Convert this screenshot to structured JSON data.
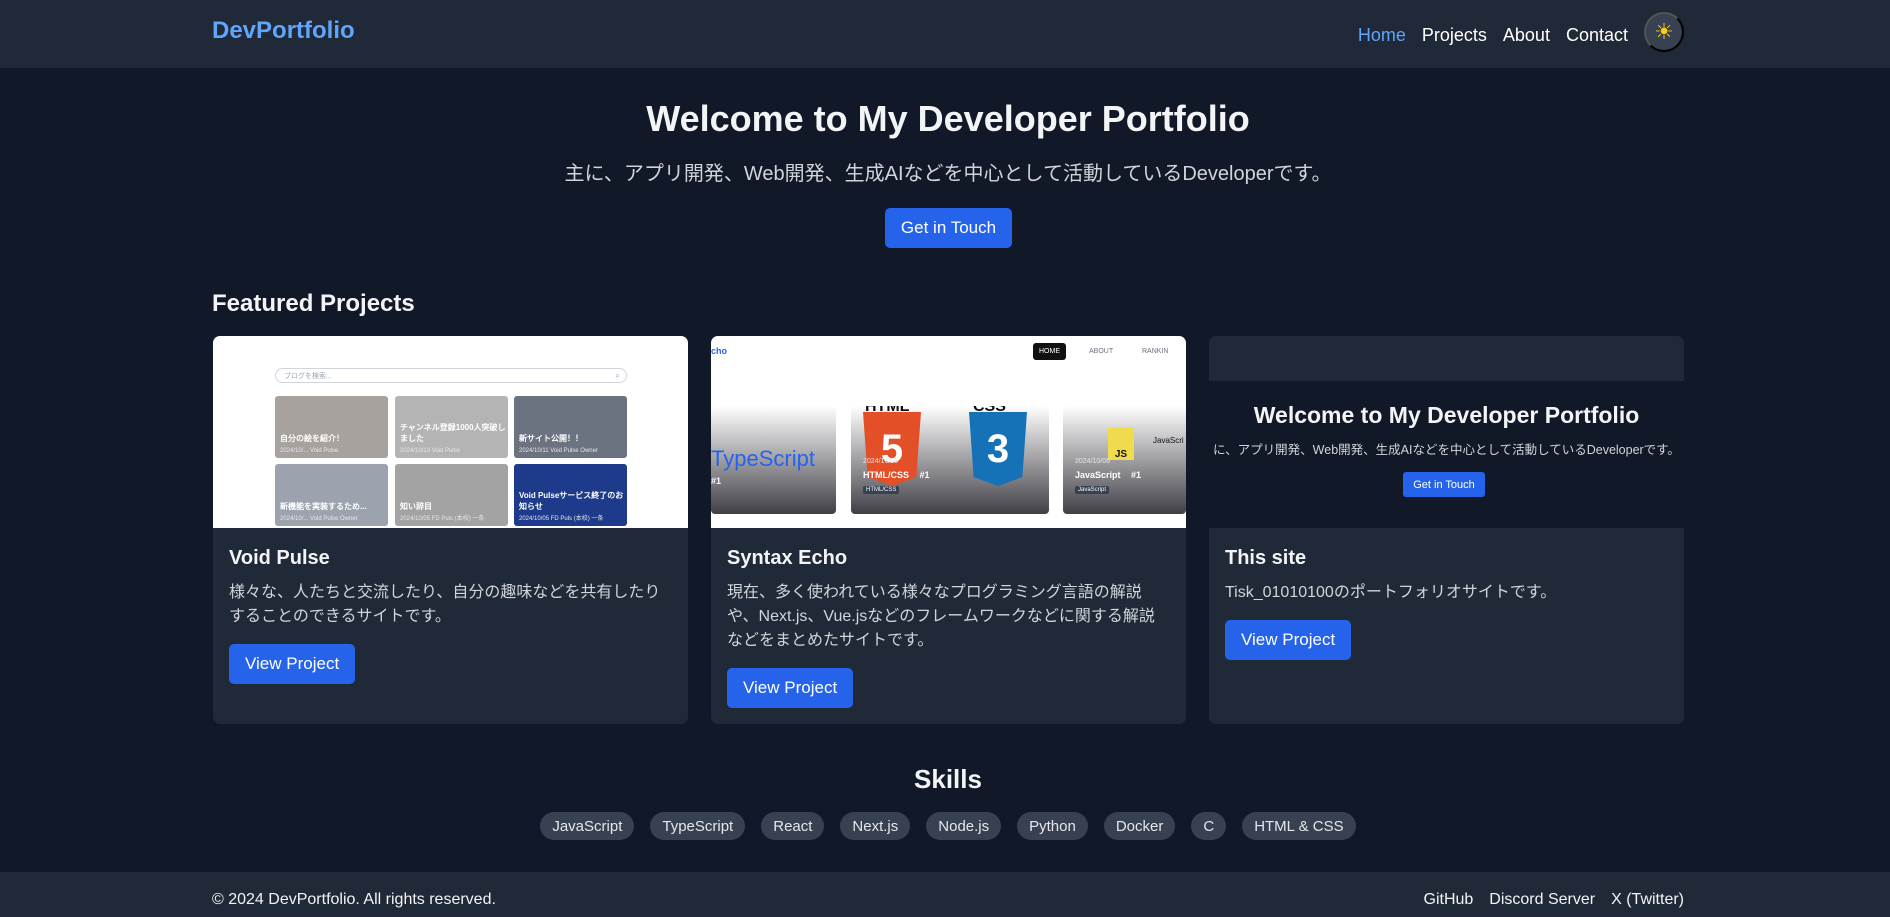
{
  "nav": {
    "brand": "DevPortfolio",
    "links": [
      "Home",
      "Projects",
      "About",
      "Contact"
    ],
    "active": "Home",
    "theme_icon": "☀",
    "theme_icon_name": "sun-icon"
  },
  "hero": {
    "title": "Welcome to My Developer Portfolio",
    "subtitle": "主に、アプリ開発、Web開発、生成AIなどを中心として活動しているDeveloperです。",
    "cta": "Get in Touch"
  },
  "projects_section": {
    "title": "Featured Projects",
    "projects": [
      {
        "title": "Void Pulse",
        "description": "様々な、人たちと交流したり、自分の趣味などを共有したりすることのできるサイトです。",
        "button": "View Project",
        "thumbnail": {
          "search_placeholder": "ブログを検索...",
          "tiles": [
            {
              "title": "自分の絵を紹介！",
              "meta": "2024/10/... Void Pulse"
            },
            {
              "title": "チャンネル登録1000人突破しました",
              "meta": "2024/10/13 Void Pulse"
            },
            {
              "title": "新サイト公開！！",
              "meta": "2024/10/11 Void Pulse Owner"
            },
            {
              "title": "新機能を実装するため...",
              "meta": "2024/10/... Void Pulse Owner"
            },
            {
              "title": "知い辞目",
              "meta": "2024/10/05 FD Puls (本校) 一条"
            },
            {
              "title": "Void Pulseサービス終了のお知らせ",
              "meta": "2024/10/05 FD Puls (本校) 一条"
            }
          ]
        }
      },
      {
        "title": "Syntax Echo",
        "description": "現在、多く使われている様々なプログラミング言語の解説や、Next.js、Vue.jsなどのフレームワークなどに関する解説などをまとめたサイトです。",
        "button": "View Project",
        "thumbnail": {
          "logo": "cho",
          "nav": [
            "HOME",
            "ABOUT",
            "RANKIN"
          ],
          "slides": [
            {
              "label": "TypeScript",
              "rank": "#1"
            },
            {
              "date": "2024/10/06",
              "label": "HTML/CSS",
              "rank": "#1",
              "tag": "HTML/CSS"
            },
            {
              "date": "2024/10/06",
              "label": "JavaScript",
              "rank": "#1",
              "tag": "JavaScript"
            }
          ],
          "html_text": "HTML",
          "css_text": "CSS",
          "html_number": "5",
          "css_number": "3",
          "js_text": "JS",
          "side_text": "JavaScri"
        }
      },
      {
        "title": "This site",
        "description": "Tisk_01010100のポートフォリオサイトです。",
        "button": "View Project",
        "thumbnail": {
          "title": "Welcome to My Developer Portfolio",
          "subtitle": "に、アプリ開発、Web開発、生成AIなどを中心として活動しているDeveloperです。",
          "cta": "Get in Touch"
        }
      }
    ]
  },
  "skills": {
    "title": "Skills",
    "items": [
      "JavaScript",
      "TypeScript",
      "React",
      "Next.js",
      "Node.js",
      "Python",
      "Docker",
      "C",
      "HTML & CSS"
    ]
  },
  "footer": {
    "copyright": "© 2024 DevPortfolio. All rights reserved.",
    "links": [
      "GitHub",
      "Discord Server",
      "X (Twitter)"
    ]
  },
  "colors": {
    "background": "#111827",
    "surface": "#1f2937",
    "accent": "#2563eb",
    "brand": "#60a5fa",
    "chip": "#374151"
  }
}
